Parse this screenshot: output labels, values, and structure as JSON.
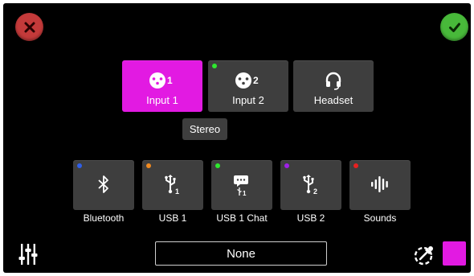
{
  "header": {
    "cancel_icon": "close-icon",
    "confirm_icon": "check-icon",
    "cancel_color": "#c43a3a",
    "confirm_color": "#48b93a"
  },
  "sources": [
    {
      "label": "Input 1",
      "icon": "combo-input-icon",
      "badge": "1",
      "selected": true,
      "indicator_color": null
    },
    {
      "label": "Input 2",
      "icon": "combo-input-icon",
      "badge": "2",
      "selected": false,
      "indicator_color": "#2ee82e"
    },
    {
      "label": "Headset",
      "icon": "headset-icon",
      "badge": "",
      "selected": false,
      "indicator_color": null
    }
  ],
  "stereo_label": "Stereo",
  "outputs": [
    {
      "label": "Bluetooth",
      "icon": "bluetooth-icon",
      "indicator_color": "#2f5fe8"
    },
    {
      "label": "USB 1",
      "icon": "usb-icon",
      "indicator_color": "#f08a20"
    },
    {
      "label": "USB 1 Chat",
      "icon": "usb-chat-icon",
      "indicator_color": "#2ee82e"
    },
    {
      "label": "USB 2",
      "icon": "usb-icon",
      "indicator_color": "#a020e8"
    },
    {
      "label": "Sounds",
      "icon": "soundwave-icon",
      "indicator_color": "#e82020"
    }
  ],
  "footer": {
    "none_label": "None",
    "mixer_icon": "mixer-sliders-icon",
    "picker_icon": "color-picker-icon",
    "selected_color": "#e21ae2"
  },
  "colors": {
    "accent": "#e21ae2",
    "tile": "#3e3e3e",
    "background": "#000000"
  }
}
